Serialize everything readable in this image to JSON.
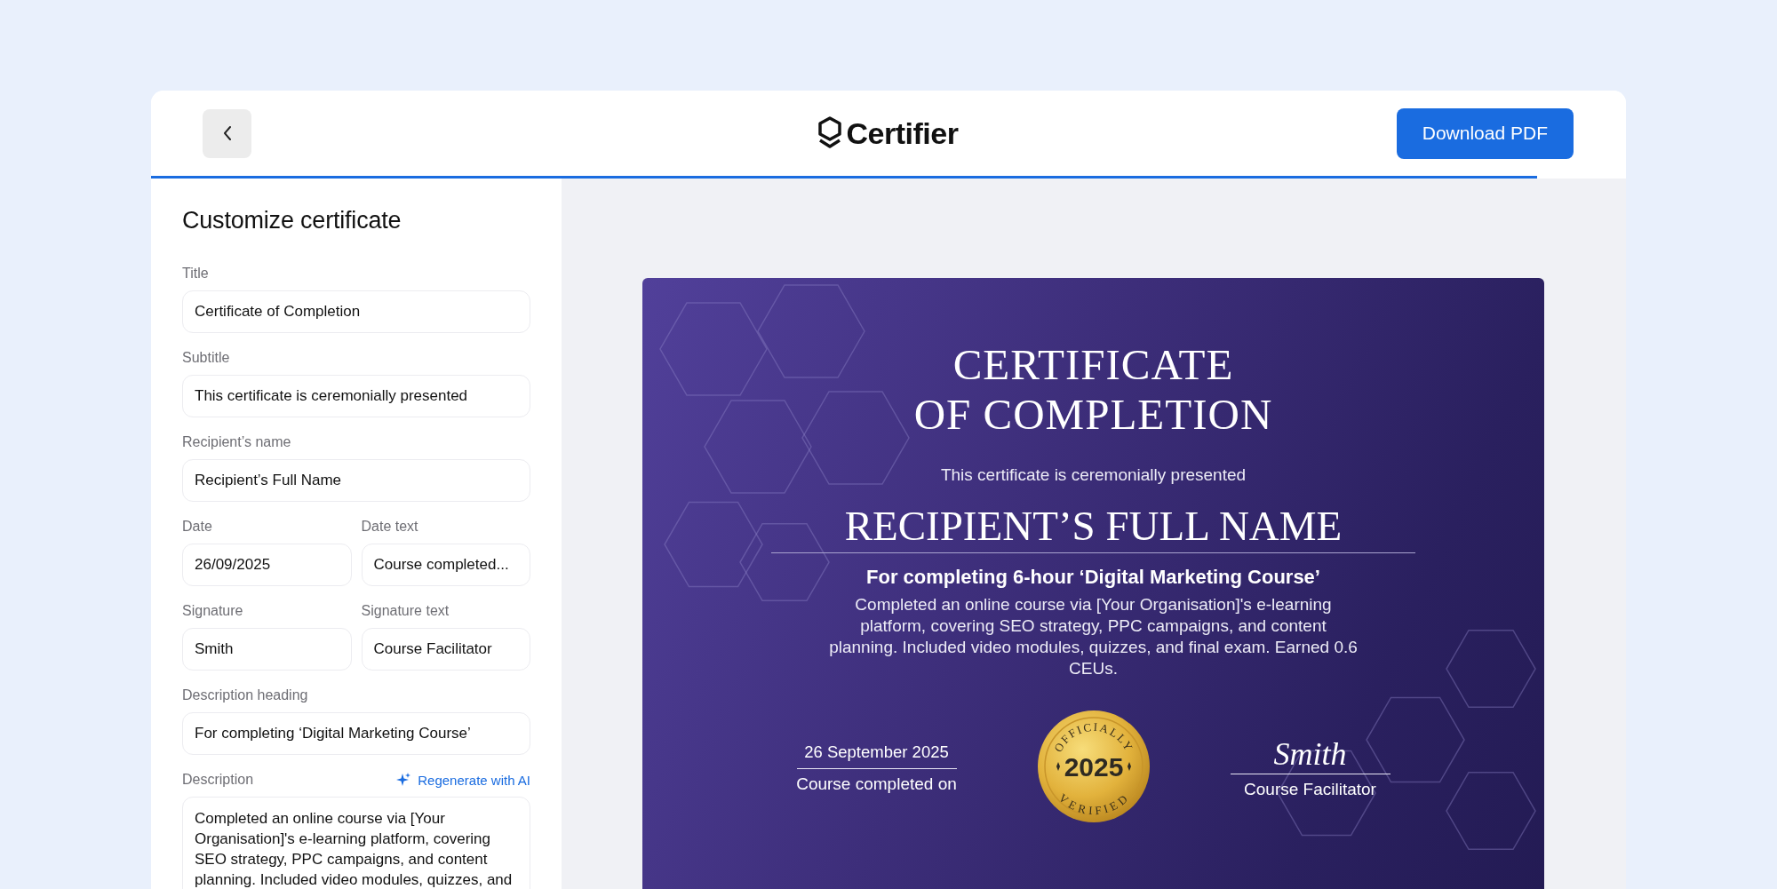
{
  "header": {
    "logo_text": "Certifier",
    "download_button": "Download PDF"
  },
  "progress": {
    "level": 0.94
  },
  "panel": {
    "heading": "Customize certificate",
    "rows": [
      [
        {
          "kind": "input",
          "label": "Title",
          "value": "Certificate of Completion"
        }
      ],
      [
        {
          "kind": "input",
          "label": "Subtitle",
          "value": "This certificate is ceremonially presented"
        }
      ],
      [
        {
          "kind": "input",
          "label": "Recipient’s name",
          "value": "Recipient’s Full Name"
        }
      ],
      [
        {
          "kind": "input",
          "label": "Date",
          "value": "26/09/2025"
        },
        {
          "kind": "input",
          "label": "Date text",
          "value": "Course completed..."
        }
      ],
      [
        {
          "kind": "input",
          "label": "Signature",
          "value": "Smith"
        },
        {
          "kind": "input",
          "label": "Signature text",
          "value": "Course Facilitator"
        }
      ],
      [
        {
          "kind": "input",
          "label": "Description heading",
          "value": "For completing ‘Digital Marketing Course’"
        }
      ],
      [
        {
          "kind": "textarea",
          "label": "Description",
          "action": "Regenerate with AI",
          "value": "Completed an online course via [Your Organisation]'s e-learning platform, covering SEO strategy, PPC campaigns, and content planning. Included video modules, quizzes, and"
        }
      ]
    ]
  },
  "certificate": {
    "title_lines": [
      "CERTIFICATE",
      "OF COMPLETION"
    ],
    "subtitle": "This certificate is ceremonially presented",
    "recipient": "RECIPIENT’S FULL NAME",
    "heading": "For completing 6-hour ‘Digital Marketing Course’",
    "description": "Completed an online course via [Your Organisation]'s e-learning platform, covering SEO strategy, PPC campaigns, and content planning. Included video modules, quizzes, and final exam. Earned 0.6 CEUs.",
    "date": "26 September 2025",
    "date_caption": "Course completed on",
    "seal": {
      "top": "OFFICIALLY",
      "year": "2025",
      "bottom": "VERIFIED"
    },
    "signature": "Smith",
    "signature_caption": "Course Facilitator"
  }
}
